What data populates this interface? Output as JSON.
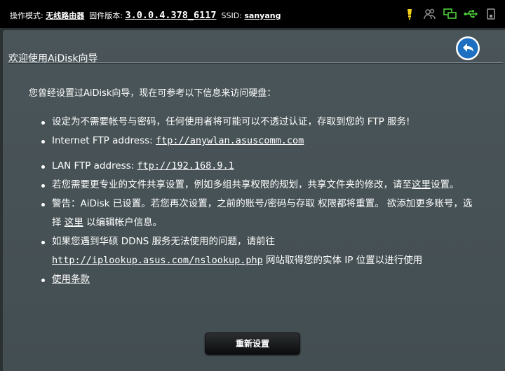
{
  "topbar": {
    "op_mode_label": "操作模式:",
    "op_mode_value": "无线路由器",
    "firmware_label": "固件版本:",
    "firmware_value": "3.0.0.4.378_6117",
    "ssid_label": "SSID:",
    "ssid_value": "sanyang",
    "icons": [
      "notification-icon",
      "clients-icon",
      "network-icon",
      "usb-icon",
      "status-icon"
    ]
  },
  "panel": {
    "title": "欢迎使用AiDisk向导",
    "intro": "您曾经设置过AiDisk向导，现在可参考以下信息来访问硬盘：",
    "item1": "设定为不需要帐号与密码，任何使用者将可能可以不透过认证，存取到您的 FTP 服务!",
    "item2_prefix": "Internet FTP address: ",
    "item2_link": "ftp://anywlan.asuscomm.com",
    "item3_prefix": "LAN FTP address: ",
    "item3_link": "ftp://192.168.9.1",
    "item4_text": "若您需要更专业的文件共享设置，例如多组共享权限的规划，共享文件夹的修改，请至",
    "item4_link": "这里",
    "item4_suffix": "设置。",
    "item5_text": "警告：AiDisk 已设置。若您再次设置，之前的账号/密码与存取 权限都将重置。 欲添加更多账号，选择 ",
    "item5_link": "这里",
    "item5_suffix": " 以编辑帐户信息。",
    "item6_text": "如果您遇到华硕 DDNS 服务无法使用的问题，请前往 ",
    "item6_link": "http://iplookup.asus.com/nslookup.php",
    "item6_suffix": " 网站取得您的实体 IP 位置以进行使用",
    "item7_link": "使用条款",
    "reset_button": "重新设置"
  },
  "colors": {
    "background": "#2b3133",
    "panel": "#4a5559",
    "back_button": "#1d6fc1",
    "icon_yellow": "#f7d21a",
    "icon_green": "#4fd13a"
  }
}
